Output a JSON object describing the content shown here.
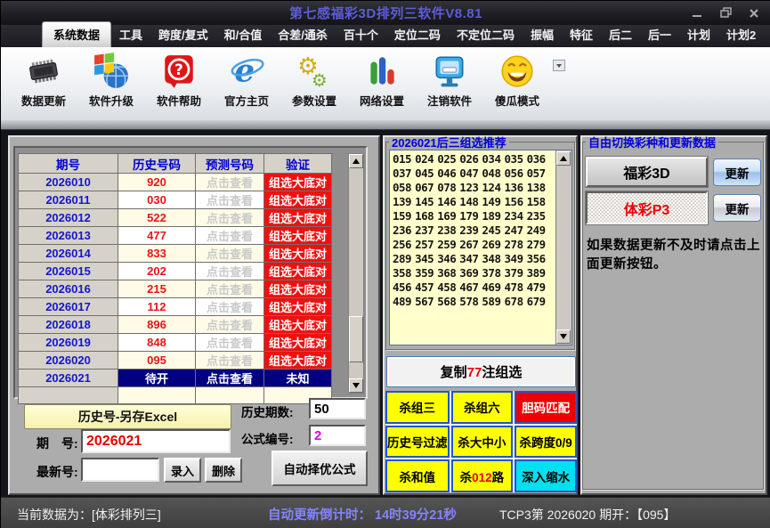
{
  "window": {
    "title": "第七感福彩3D排列三软件V8.81"
  },
  "menu": {
    "tabs": [
      {
        "label": "系统数据",
        "active": true
      },
      {
        "label": "工具"
      },
      {
        "label": "跨度/复式"
      },
      {
        "label": "和/合值"
      },
      {
        "label": "合差/通杀"
      },
      {
        "label": "百十个"
      },
      {
        "label": "定位二码"
      },
      {
        "label": "不定位二码"
      },
      {
        "label": "振幅"
      },
      {
        "label": "特征"
      },
      {
        "label": "后二"
      },
      {
        "label": "后一"
      },
      {
        "label": "计划"
      },
      {
        "label": "计划2"
      }
    ]
  },
  "toolbar": {
    "items": [
      {
        "label": "数据更新",
        "icon": "chip-icon"
      },
      {
        "label": "软件升级",
        "icon": "upgrade-icon"
      },
      {
        "label": "软件帮助",
        "icon": "help-icon"
      },
      {
        "label": "官方主页",
        "icon": "homepage-ie-icon"
      },
      {
        "label": "参数设置",
        "icon": "gears-icon"
      },
      {
        "label": "网络设置",
        "icon": "network-bars-icon"
      },
      {
        "label": "注销软件",
        "icon": "logout-monitor-icon"
      },
      {
        "label": "傻瓜模式",
        "icon": "smiley-icon"
      }
    ]
  },
  "history_table": {
    "headers": [
      "期号",
      "历史号码",
      "预测号码",
      "验证"
    ],
    "rows": [
      {
        "issue": "2026010",
        "number": "920",
        "predict": "点击查看",
        "verify": "组选大底对"
      },
      {
        "issue": "2026011",
        "number": "030",
        "predict": "点击查看",
        "verify": "组选大底对"
      },
      {
        "issue": "2026012",
        "number": "522",
        "predict": "点击查看",
        "verify": "组选大底对"
      },
      {
        "issue": "2026013",
        "number": "477",
        "predict": "点击查看",
        "verify": "组选大底对"
      },
      {
        "issue": "2026014",
        "number": "833",
        "predict": "点击查看",
        "verify": "组选大底对"
      },
      {
        "issue": "2026015",
        "number": "202",
        "predict": "点击查看",
        "verify": "组选大底对"
      },
      {
        "issue": "2026016",
        "number": "215",
        "predict": "点击查看",
        "verify": "组选大底对"
      },
      {
        "issue": "2026017",
        "number": "112",
        "predict": "点击查看",
        "verify": "组选大底对"
      },
      {
        "issue": "2026018",
        "number": "896",
        "predict": "点击查看",
        "verify": "组选大底对"
      },
      {
        "issue": "2026019",
        "number": "848",
        "predict": "点击查看",
        "verify": "组选大底对"
      },
      {
        "issue": "2026020",
        "number": "095",
        "predict": "点击查看",
        "verify": "组选大底对"
      }
    ],
    "pending_row": {
      "issue": "2026021",
      "number": "待开",
      "predict": "点击查看",
      "verify": "未知"
    }
  },
  "left_controls": {
    "export_button": "历史号-另存Excel",
    "issue_label": "期　号:",
    "issue_value": "2026021",
    "latest_label": "最新号:",
    "latest_value": "",
    "enter_button": "录入",
    "delete_button": "删除",
    "periods_label": "历史期数:",
    "periods_value": "50",
    "formula_label": "公式编号:",
    "formula_value": "2",
    "formula_color": "#e800e8",
    "auto_formula_button": "自动择优公式"
  },
  "recommend_panel": {
    "title": "2026021后三组选推荐",
    "numbers": "015 024 025 026 034 035 036 037 045 046 047 048 056 057 058 067 078 123 124 136 138 139 145 146 148 149 156 158 159 168 169 179 189 234 235 236 237 238 239 245 247 249 256 257 259 267 269 278 279 289 345 346 347 348 349 356 358 359 368 369 378 379 389 456 457 458 467 469 478 479 489 567 568 578 589 678 679",
    "copy_button": {
      "prefix": "复制",
      "count": "77",
      "suffix": "注组选"
    },
    "kill_buttons": [
      {
        "label": "杀组三",
        "bg": "#ffff00",
        "color": "#000000"
      },
      {
        "label": "杀组六",
        "bg": "#ffff00",
        "color": "#000000"
      },
      {
        "label": "胆码匹配",
        "bg": "#ee0000",
        "color": "#ffffff"
      },
      {
        "label": "历史号过滤",
        "bg": "#ffff00",
        "color": "#000000"
      },
      {
        "label": "杀大中小",
        "bg": "#ffff00",
        "color": "#000000"
      },
      {
        "label": "杀跨度0/9",
        "bg": "#ffff00",
        "color": "#000000"
      },
      {
        "label": "杀和值",
        "bg": "#ffff00",
        "color": "#000000"
      },
      {
        "label": "杀012路",
        "bg": "#ffff00",
        "color": "#000000",
        "accent": "012",
        "accent_color": "#ee0000"
      },
      {
        "label": "深入缩水",
        "bg": "#00e0f0",
        "color": "#000000"
      }
    ]
  },
  "switch_panel": {
    "title": "自由切换彩种和更新数据",
    "fucai_button": "福彩3D",
    "ticai_button": "体彩P3",
    "update_button1": "更新",
    "update_button2": "更新",
    "note": "如果数据更新不及时请点击上面更新按钮。"
  },
  "status_bar": {
    "current_data": "当前数据为：[体彩排列三]",
    "countdown_label": "自动更新倒计时：",
    "countdown_value": "14时39分21秒",
    "last_open": "TCP3第 2026020 期开：【095】"
  }
}
